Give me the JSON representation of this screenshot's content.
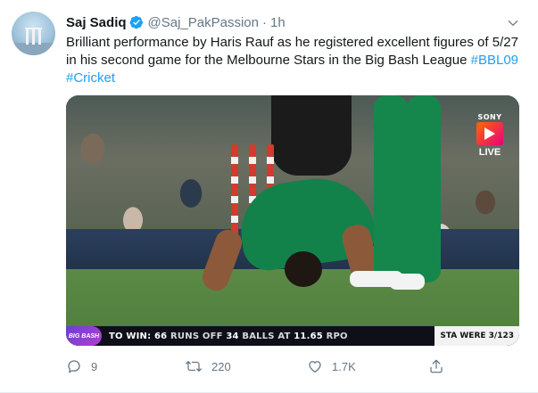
{
  "author": {
    "display_name": "Saj Sadiq",
    "handle": "@Saj_PakPassion",
    "separator": "·",
    "time": "1h",
    "verified": true
  },
  "tweet": {
    "text_plain": "Brilliant performance by Haris Rauf as he registered excellent figures of 5/27 in his second game for the Melbourne Stars in the Big Bash League ",
    "hashtags": [
      "#BBL09",
      "#Cricket"
    ]
  },
  "media": {
    "broadcaster": "SONY",
    "live_label": "LIVE",
    "scorebar": {
      "league_logo": "BIG BASH",
      "to_win_prefix": "TO WIN:",
      "runs": "66",
      "runs_label": "RUNS OFF",
      "balls": "34",
      "balls_label": "BALLS AT",
      "rpo": "11.65",
      "rpo_label": "RPO",
      "side_text": "STA WERE 3/123"
    }
  },
  "actions": {
    "reply_count": "9",
    "retweet_count": "220",
    "like_count": "1.7K"
  },
  "colors": {
    "accent": "#1da1f2",
    "muted": "#657786",
    "text": "#14171a",
    "verified": "#1da1f2"
  },
  "icons": [
    "avatar-image",
    "verified-badge-icon",
    "chevron-down-icon",
    "reply-icon",
    "retweet-icon",
    "like-icon",
    "share-icon"
  ]
}
